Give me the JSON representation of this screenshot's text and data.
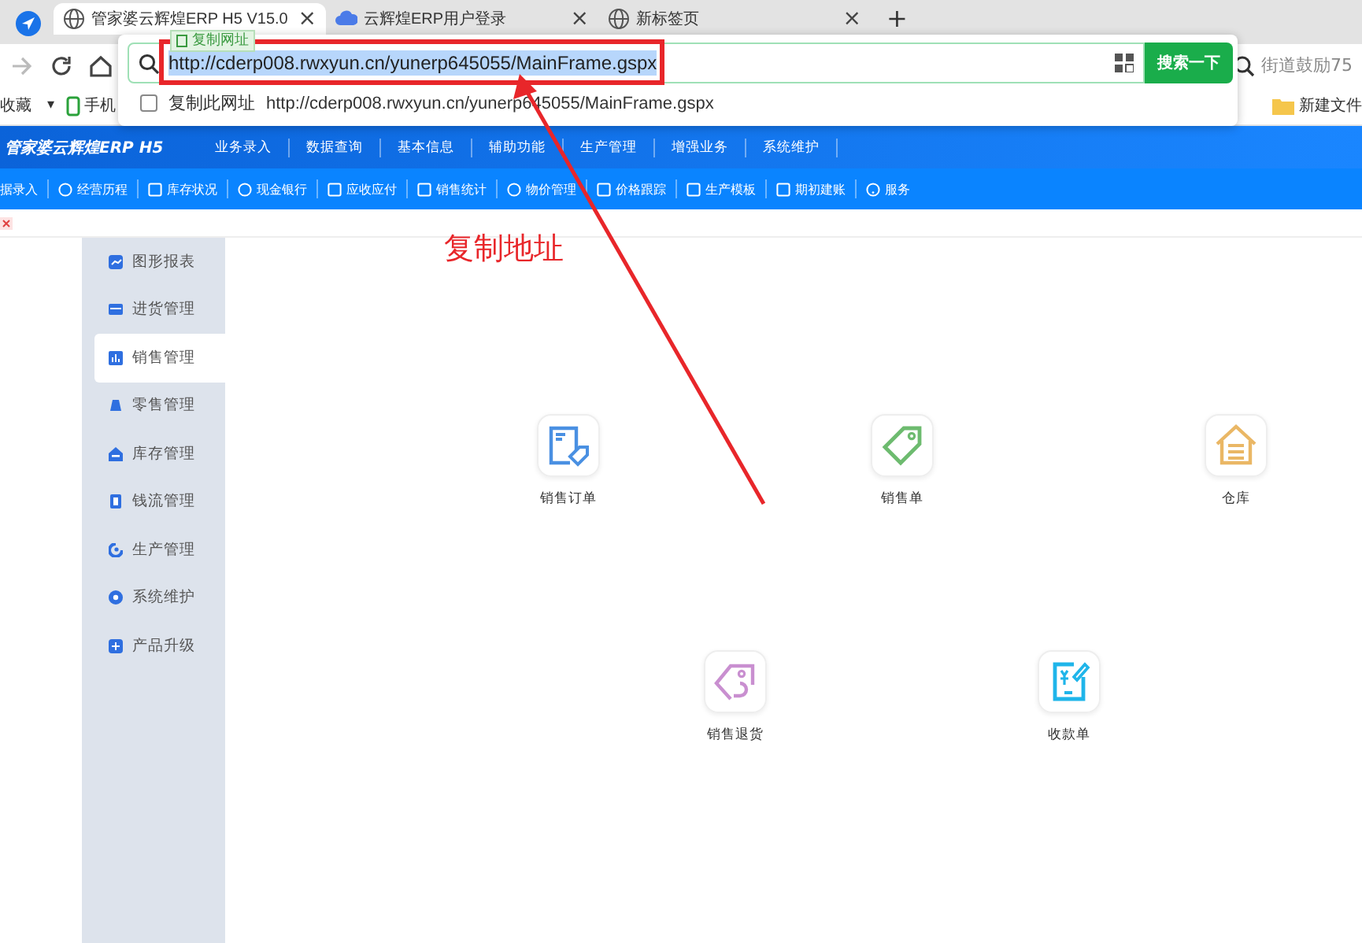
{
  "browser": {
    "tabs": [
      {
        "title": "管家婆云辉煌ERP H5 V15.0",
        "close": "×",
        "selected": true,
        "kind": "globe"
      },
      {
        "title": "云辉煌ERP用户登录",
        "close": "×",
        "selected": false,
        "kind": "cloud"
      },
      {
        "title": "新标签页",
        "close": "×",
        "selected": false,
        "kind": "globe"
      }
    ],
    "new_tab": "+",
    "tooltip": "复制网址",
    "can_go_forward": false,
    "address": {
      "checked": false,
      "value": "http://cderp008.rwxyun.cn/yunerp645055/MainFrame.gspx",
      "button": "搜索一下",
      "suggestion_label": "复制此网址",
      "suggestion_url": "http://cderp008.rwxyun.cn/yunerp645055/MainFrame.gspx"
    },
    "search": {
      "placeholder": "街道鼓励75"
    },
    "bookmarks_menu": {
      "label": "收藏",
      "caret": "▾"
    },
    "bookmarks": [
      {
        "label": "手机",
        "kind": "phone"
      },
      {
        "label": "新建文件",
        "kind": "folder"
      }
    ]
  },
  "app": {
    "logo": "管家婆云辉煌ERP H5",
    "menu": [
      "业务录入",
      "数据查询",
      "基本信息",
      "辅助功能",
      "生产管理",
      "增强业务",
      "系统维护"
    ],
    "toolbar": [
      {
        "label": "据录入",
        "kind": "none"
      },
      {
        "label": "经营历程",
        "kind": "circle"
      },
      {
        "label": "库存状况",
        "kind": "square"
      },
      {
        "label": "现金银行",
        "kind": "circle"
      },
      {
        "label": "应收应付",
        "kind": "square"
      },
      {
        "label": "销售统计",
        "kind": "square"
      },
      {
        "label": "物价管理",
        "kind": "circle"
      },
      {
        "label": "价格跟踪",
        "kind": "square"
      },
      {
        "label": "生产模板",
        "kind": "square"
      },
      {
        "label": "期初建账",
        "kind": "square"
      },
      {
        "label": "服务",
        "kind": "help"
      }
    ]
  },
  "sidebar": [
    {
      "label": "图形报表",
      "kind": "chart",
      "selected": false
    },
    {
      "label": "进货管理",
      "kind": "box",
      "selected": false
    },
    {
      "label": "销售管理",
      "kind": "bars",
      "selected": true
    },
    {
      "label": "零售管理",
      "kind": "bell",
      "selected": false
    },
    {
      "label": "库存管理",
      "kind": "house",
      "selected": false
    },
    {
      "label": "钱流管理",
      "kind": "wallet",
      "selected": false
    },
    {
      "label": "生产管理",
      "kind": "gauge",
      "selected": false
    },
    {
      "label": "系统维护",
      "kind": "gear",
      "selected": false
    },
    {
      "label": "产品升级",
      "kind": "plus",
      "selected": false
    }
  ],
  "annotation": {
    "text": "复制地址"
  },
  "tiles": [
    [
      {
        "label": "销售订单",
        "kind": "order",
        "color": "#4a90e2"
      },
      {
        "label": "销售单",
        "kind": "tag",
        "color": "#6dbb6f"
      },
      {
        "label": "仓库",
        "kind": "house",
        "color": "#eab765"
      }
    ],
    [
      {
        "label": "销售退货",
        "kind": "return",
        "color": "#c98fd0"
      },
      {
        "label": "收款单",
        "kind": "receipt",
        "color": "#1fb5ea"
      }
    ]
  ]
}
